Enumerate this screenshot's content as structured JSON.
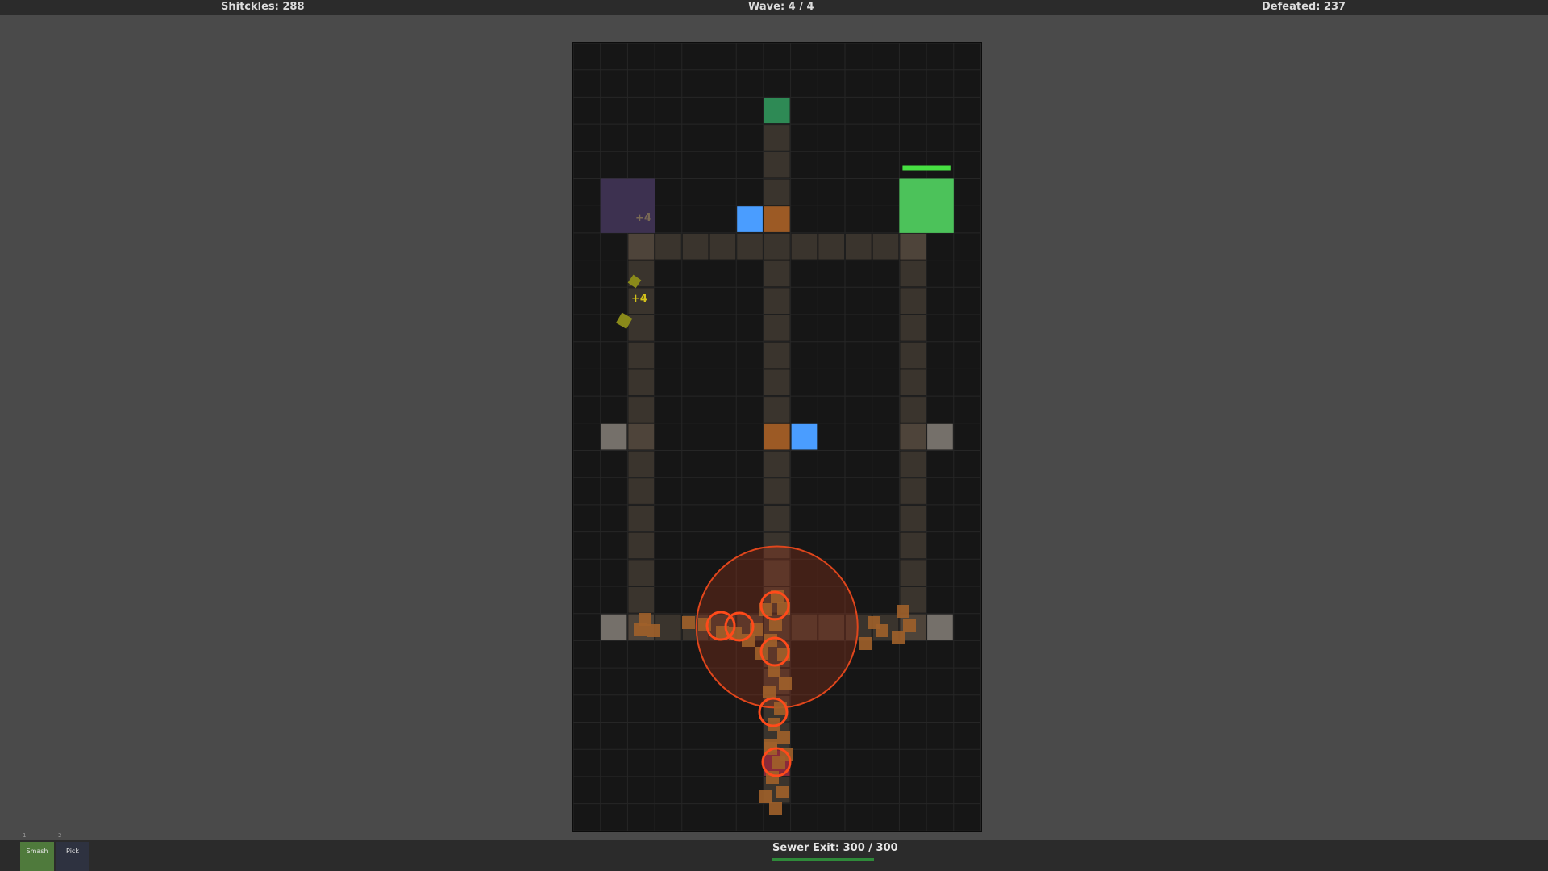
{
  "hud": {
    "shitckles": "Shitckles: 288",
    "wave": "Wave: 4 / 4",
    "defeated": "Defeated: 237"
  },
  "board": {
    "floaters": [
      "+4",
      "+4"
    ],
    "tower_health_fraction": 1.0
  },
  "toolbar": {
    "smash_label": "Smash",
    "smash_key": "1",
    "pick_label": "Pick",
    "pick_key": "2"
  },
  "exit": {
    "label": "Sewer Exit: 300 / 300",
    "fraction": 1.0
  },
  "colors": {
    "path": "#3a342d",
    "spawn": "#2e8a55",
    "orange_block": "#9c5a25",
    "blue_block": "#4a9dff",
    "purple_tower": "#3d3150",
    "green_tower": "#4cc25a",
    "aura": "#e0461c",
    "enemy": "#a0612a",
    "exit_marker": "#8a2a3a"
  }
}
